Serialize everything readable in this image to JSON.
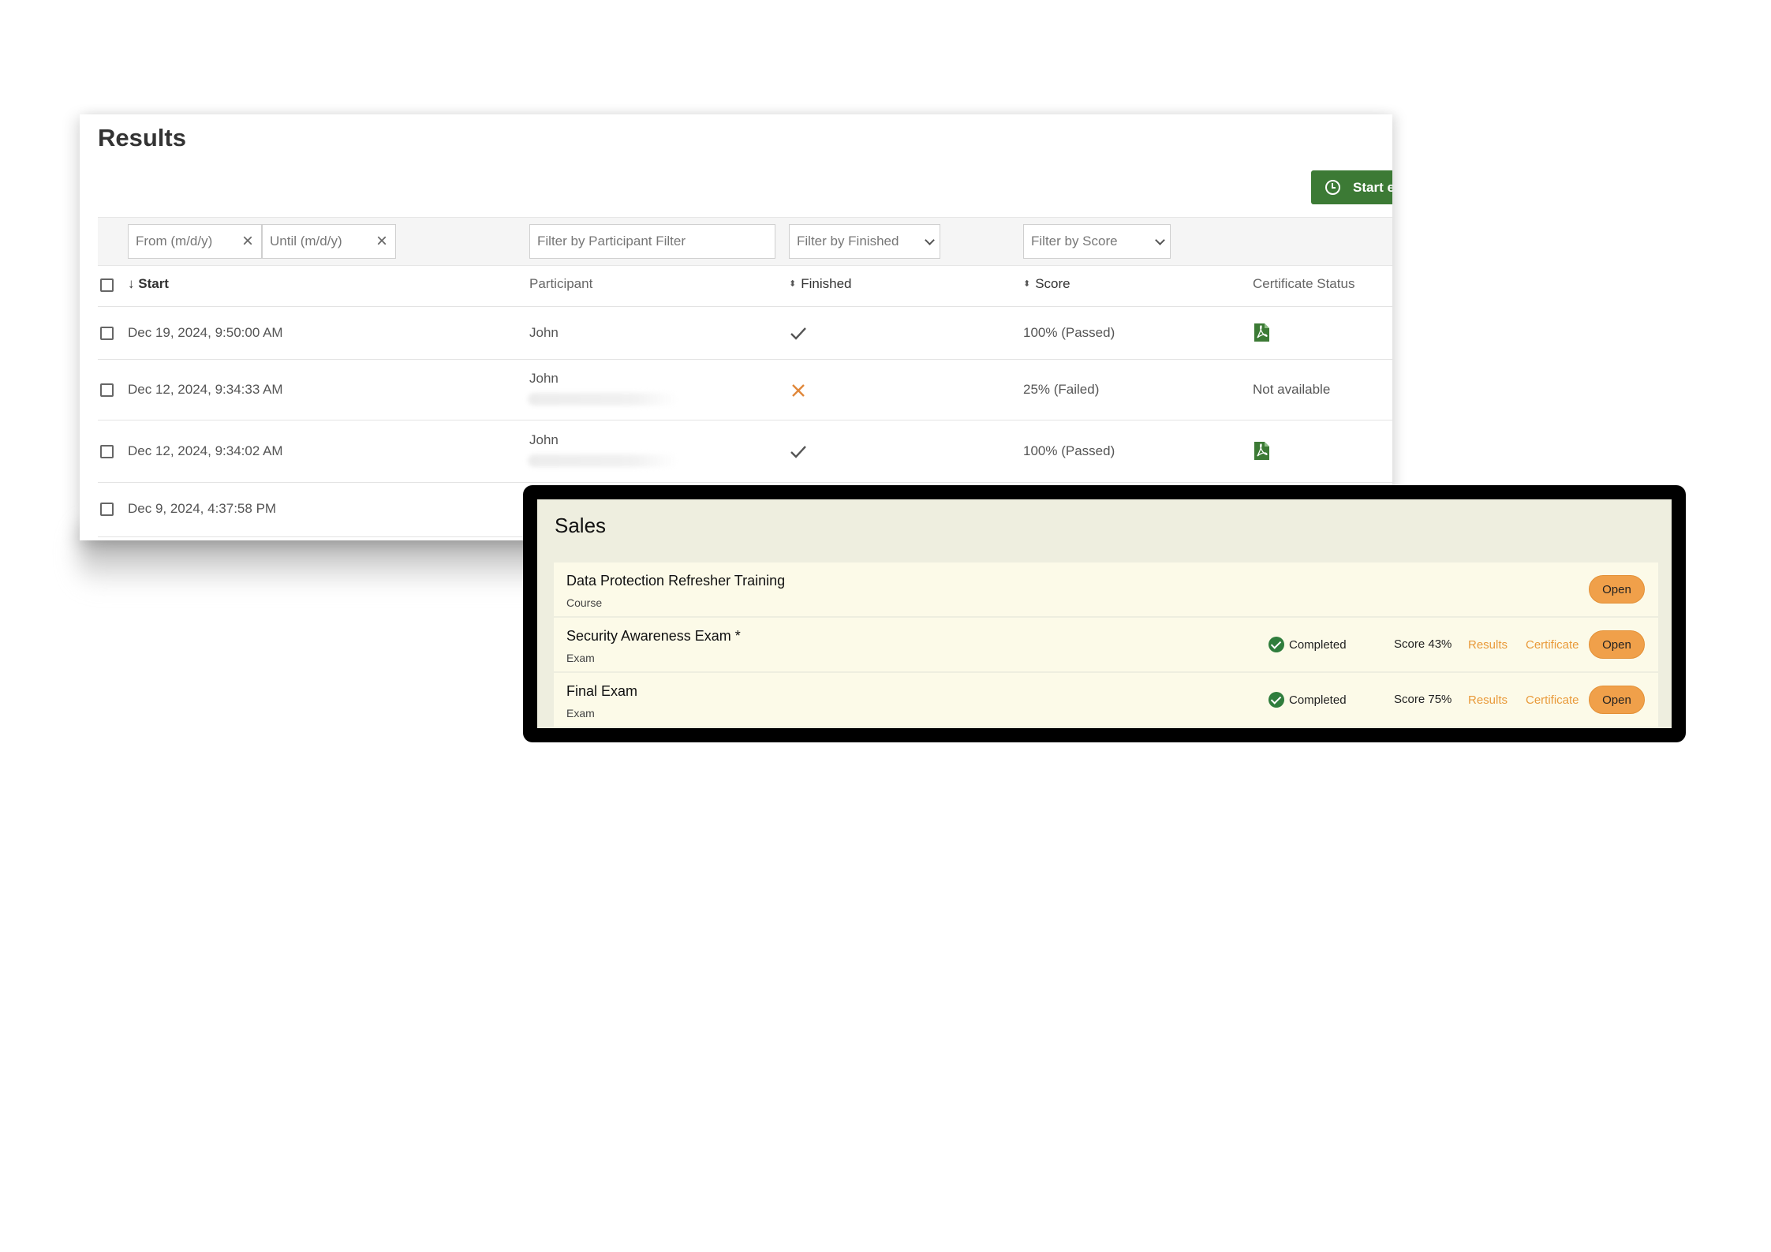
{
  "results": {
    "title": "Results",
    "start_button_label": "Start e",
    "filters": {
      "from_placeholder": "From (m/d/y)",
      "until_placeholder": "Until (m/d/y)",
      "participant_placeholder": "Filter by Participant Filter",
      "finished_selected": "Filter by Finished",
      "score_selected": "Filter by Score",
      "clear_glyph": "×"
    },
    "columns": {
      "start": "Start",
      "participant": "Participant",
      "finished": "Finished",
      "score": "Score",
      "certificate": "Certificate Status"
    },
    "rows": [
      {
        "start": "Dec 19, 2024, 9:50:00 AM",
        "participant": "John",
        "finished": "check",
        "score": "100% (Passed)",
        "certificate": "pdf-icon"
      },
      {
        "start": "Dec 12, 2024, 9:34:33 AM",
        "participant": "John",
        "finished": "cross",
        "score": "25% (Failed)",
        "certificate": "Not available"
      },
      {
        "start": "Dec 12, 2024, 9:34:02 AM",
        "participant": "John",
        "finished": "check",
        "score": "100% (Passed)",
        "certificate": "pdf-icon"
      },
      {
        "start": "Dec 9, 2024, 4:37:58 PM"
      }
    ],
    "colors": {
      "accent_green": "#3c7a35",
      "fail_orange": "#e0873a"
    }
  },
  "sales": {
    "title": "Sales",
    "items": [
      {
        "name": "Data Protection Refresher Training",
        "type": "Course",
        "open_label": "Open"
      },
      {
        "name": "Security Awareness Exam *",
        "type": "Exam",
        "status": "Completed",
        "score": "Score 43%",
        "results_label": "Results",
        "certificate_label": "Certificate",
        "open_label": "Open"
      },
      {
        "name": "Final Exam",
        "type": "Exam",
        "status": "Completed",
        "score": "Score 75%",
        "results_label": "Results",
        "certificate_label": "Certificate",
        "open_label": "Open"
      }
    ],
    "colors": {
      "background": "#eeeedf",
      "row": "#fcfae8",
      "button": "#f0a04a",
      "link": "#e99a3a",
      "ok": "#2f7d3c"
    }
  }
}
